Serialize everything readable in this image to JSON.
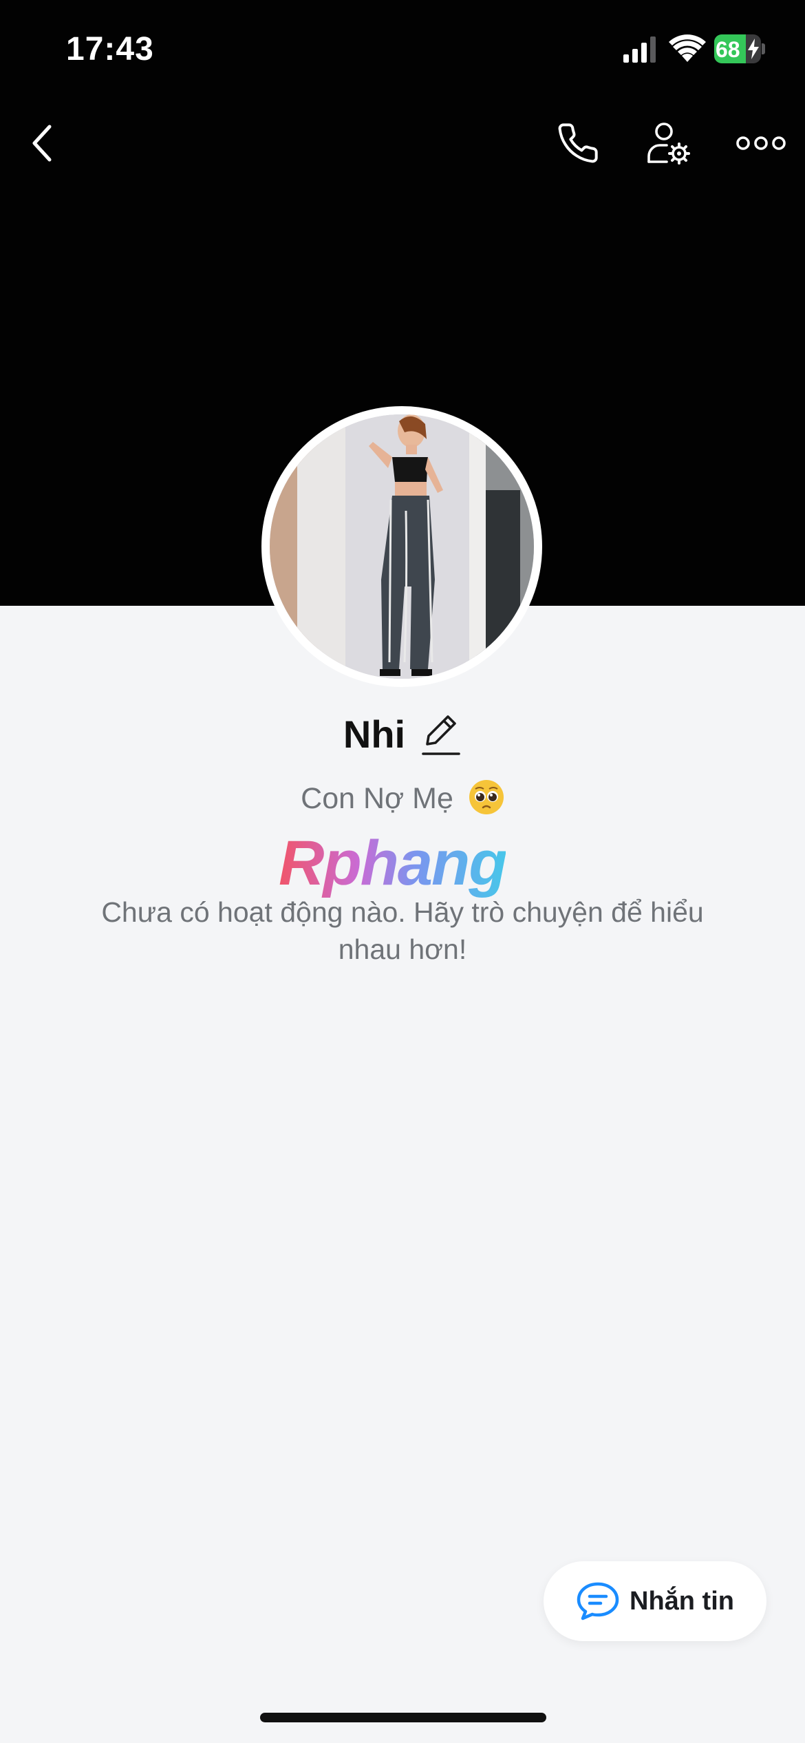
{
  "status_bar": {
    "time": "17:43",
    "battery_level": 68,
    "battery_charging": true
  },
  "nav": {
    "back_icon": "chevron-left-icon",
    "call_icon": "phone-icon",
    "settings_icon": "user-gear-icon",
    "more_icon": "more-horizontal-icon"
  },
  "profile": {
    "name": "Nhi",
    "bio": "Con Nợ Mẹ",
    "bio_emoji": "pleading-face-emoji",
    "watermark": "Rphang"
  },
  "activity": {
    "empty_message": "Chưa có hoạt động nào. Hãy trò chuyện để hiểu nhau hơn!"
  },
  "message_button": {
    "label": "Nhắn tin",
    "icon": "chat-bubble-icon"
  },
  "colors": {
    "cover_background": "#020202",
    "page_background": "#f4f5f7",
    "accent_blue": "#1a8cff",
    "battery_green": "#34c759"
  }
}
